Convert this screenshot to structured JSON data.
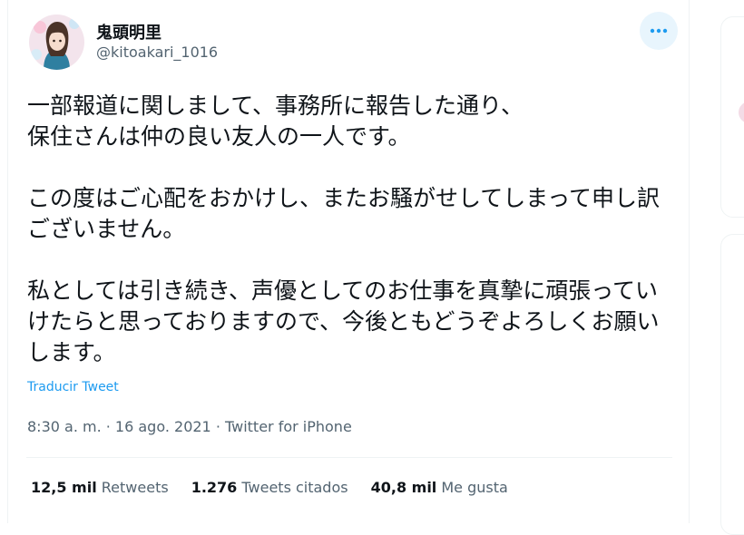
{
  "tweet": {
    "display_name": "鬼頭明里",
    "handle": "@kitoakari_1016",
    "text": "一部報道に関しまして、事務所に報告した通り、\n保住さんは仲の良い友人の一人です。\n\nこの度はご心配をおかけし、またお騒がせしてしまって申し訳ございません。\n\n私としては引き続き、声優としてのお仕事を真摯に頑張っていけたらと思っておりますので、今後ともどうぞよろしくお願いします。",
    "translate_label": "Traducir Tweet",
    "meta": "8:30 a. m. · 16 ago. 2021 · Twitter for iPhone",
    "more_icon": "more-horizontal-icon"
  },
  "stats": [
    {
      "count": "12,5 mil",
      "label": "Retweets"
    },
    {
      "count": "1.276",
      "label": "Tweets citados"
    },
    {
      "count": "40,8 mil",
      "label": "Me gusta"
    }
  ],
  "colors": {
    "accent": "#1d9bf0",
    "text": "#0f1419",
    "secondary": "#536471",
    "border": "#eff3f4"
  }
}
